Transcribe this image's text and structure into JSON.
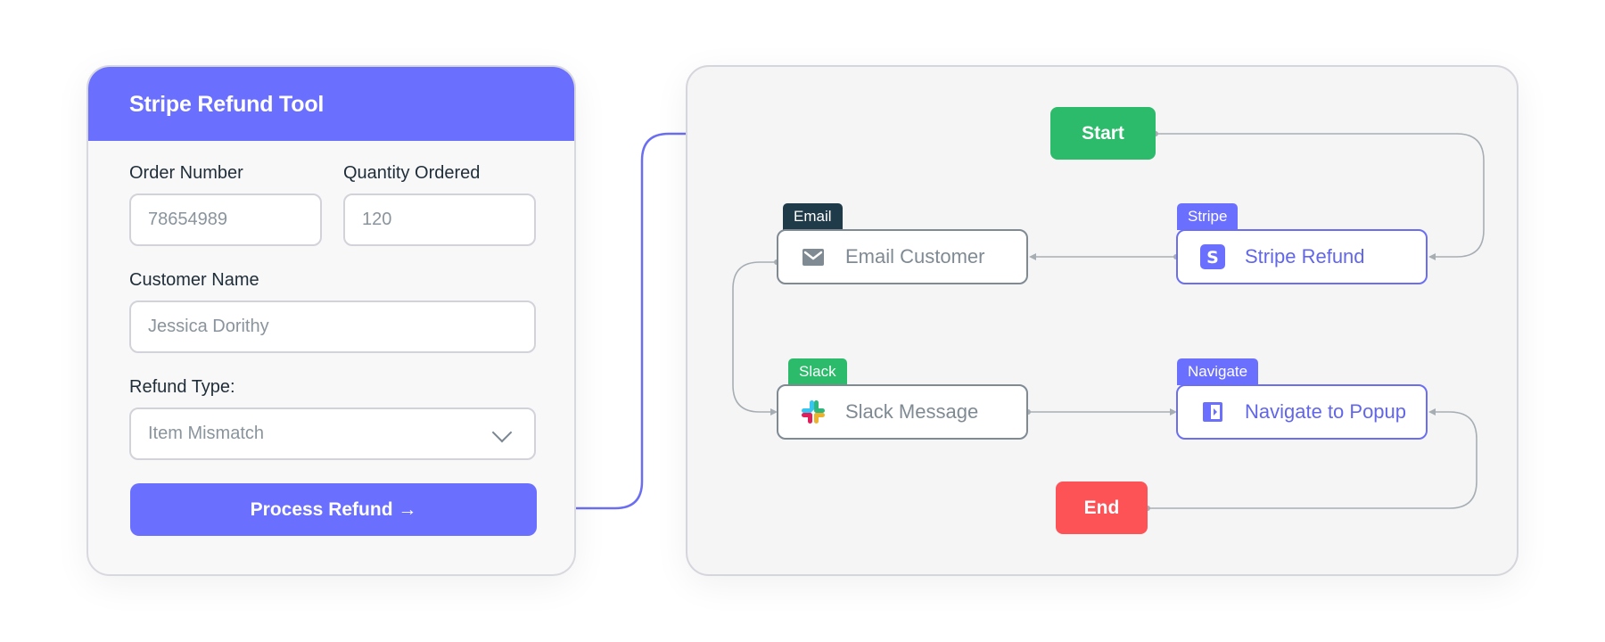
{
  "form": {
    "title": "Stripe Refund Tool",
    "order_number": {
      "label": "Order Number",
      "value": "78654989"
    },
    "quantity_ordered": {
      "label": "Quantity Ordered",
      "value": "120"
    },
    "customer_name": {
      "label": "Customer Name",
      "value": "Jessica Dorithy"
    },
    "refund_type": {
      "label": "Refund Type:",
      "selected": "Item Mismatch"
    },
    "submit_label": "Process Refund →"
  },
  "workflow": {
    "start": {
      "label": "Start"
    },
    "end": {
      "label": "End"
    },
    "nodes": {
      "email": {
        "tag": "Email",
        "label": "Email Customer",
        "icon": "envelope-icon"
      },
      "stripe": {
        "tag": "Stripe",
        "label": "Stripe Refund",
        "icon": "stripe-icon"
      },
      "slack": {
        "tag": "Slack",
        "label": "Slack Message",
        "icon": "slack-icon"
      },
      "navigate": {
        "tag": "Navigate",
        "label": "Navigate to Popup",
        "icon": "panel-icon"
      }
    },
    "edges": [
      [
        "form",
        "start"
      ],
      [
        "start",
        "stripe"
      ],
      [
        "stripe",
        "email"
      ],
      [
        "email",
        "slack"
      ],
      [
        "slack",
        "navigate"
      ],
      [
        "end",
        "navigate"
      ]
    ]
  },
  "colors": {
    "brand": "#6b6ffe",
    "start": "#2bbb6a",
    "end": "#fd5356",
    "email_tag": "#1f3a48",
    "slack_tag": "#2bbb6a",
    "wire": "#a7aeb3"
  }
}
